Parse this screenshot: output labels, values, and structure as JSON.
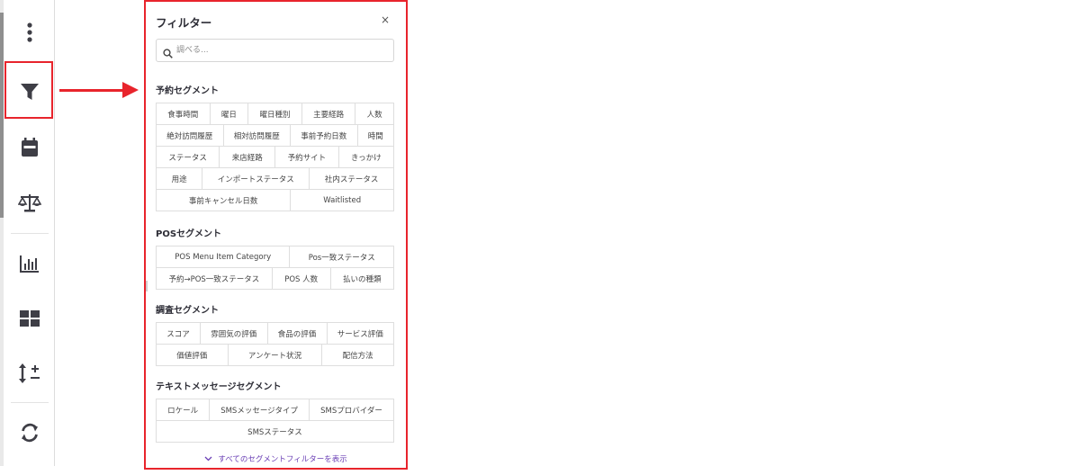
{
  "colors": {
    "highlight": "#e8242c",
    "link": "#6a3fb5",
    "icon": "#3e3e46"
  },
  "toolbar": {
    "icons": [
      "kebab-menu-icon",
      "filter-icon",
      "calendar-icon",
      "balance-scale-icon",
      "bar-chart-icon",
      "grid-layout-icon",
      "sort-plus-minus-icon",
      "refresh-icon"
    ]
  },
  "panel": {
    "title": "フィルター",
    "close": "×",
    "search_placeholder": "調べる...",
    "sections": [
      {
        "title": "予約セグメント",
        "rows": [
          [
            "食事時間",
            "曜日",
            "曜日種別",
            "主要経路",
            "人数"
          ],
          [
            "絶対訪問履歴",
            "相対訪問履歴",
            "事前予約日数",
            "時間"
          ],
          [
            "ステータス",
            "来店経路",
            "予約サイト",
            "きっかけ"
          ],
          [
            "用途",
            "インポートステータス",
            "社内ステータス"
          ],
          [
            "事前キャンセル日数",
            "Waitlisted"
          ]
        ]
      },
      {
        "title": "POSセグメント",
        "rows": [
          [
            "POS Menu Item Category",
            "Pos一致ステータス"
          ],
          [
            "予約→POS一致ステータス",
            "POS 人数",
            "払いの種類"
          ]
        ]
      },
      {
        "title": "調査セグメント",
        "rows": [
          [
            "スコア",
            "雰囲気の評価",
            "食品の評価",
            "サービス評価"
          ],
          [
            "価値評価",
            "アンケート状況",
            "配信方法"
          ]
        ]
      },
      {
        "title": "テキストメッセージセグメント",
        "rows": [
          [
            "ロケール",
            "SMSメッセージタイプ",
            "SMSプロバイダー"
          ],
          [
            "SMSステータス"
          ]
        ]
      }
    ],
    "show_all": "すべてのセグメントフィルターを表示"
  }
}
